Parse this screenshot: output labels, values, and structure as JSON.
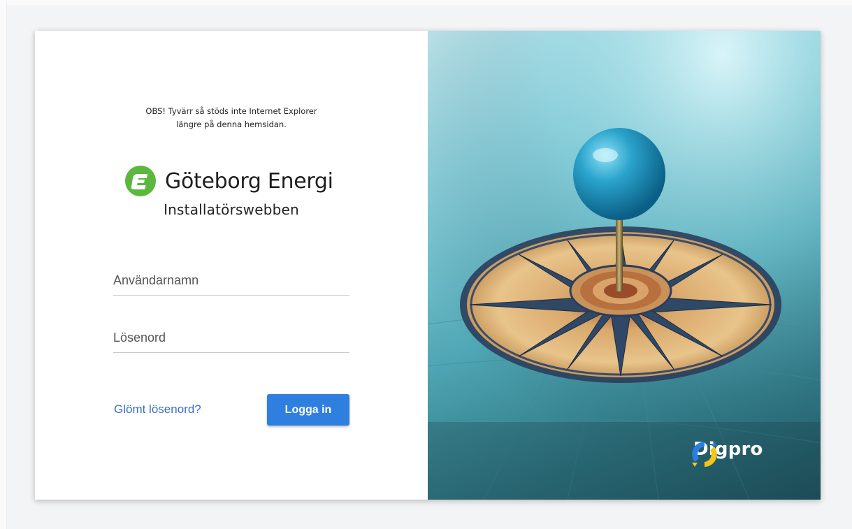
{
  "notice": {
    "line1": "OBS! Tyvärr så stöds inte Internet Explorer",
    "line2": "längre på denna hemsidan."
  },
  "brand": {
    "logo_icon": "goteborg-energi-logo-icon",
    "name": "Göteborg Energi",
    "app_name": "Installatörswebben",
    "accent_color": "#5cb73e"
  },
  "form": {
    "username_placeholder": "Användarnamn",
    "password_placeholder": "Lösenord",
    "forgot_label": "Glömt lösenord?",
    "login_label": "Logga in",
    "button_color": "#2f7fe0",
    "link_color": "#3a6fc2"
  },
  "hero": {
    "image": "compass-with-blue-map-pin",
    "partner_logo_icon": "digpro-logo-icon",
    "partner_name": "Digpro"
  }
}
